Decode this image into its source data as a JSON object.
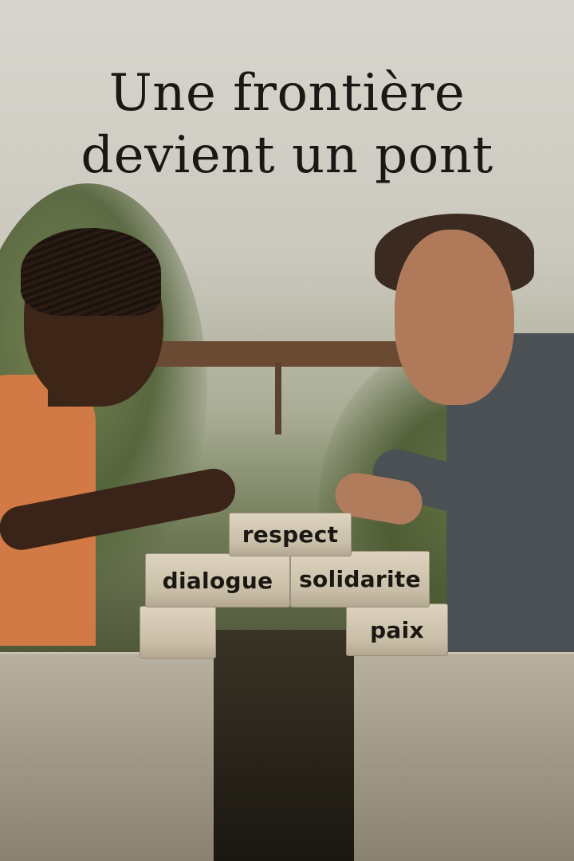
{
  "title": {
    "line1": "Une frontière",
    "line2": "devient un pont"
  },
  "bricks": {
    "top": "respect",
    "middle_left": "dialogue",
    "middle_right": "solidarite",
    "bottom_right": "paix"
  }
}
